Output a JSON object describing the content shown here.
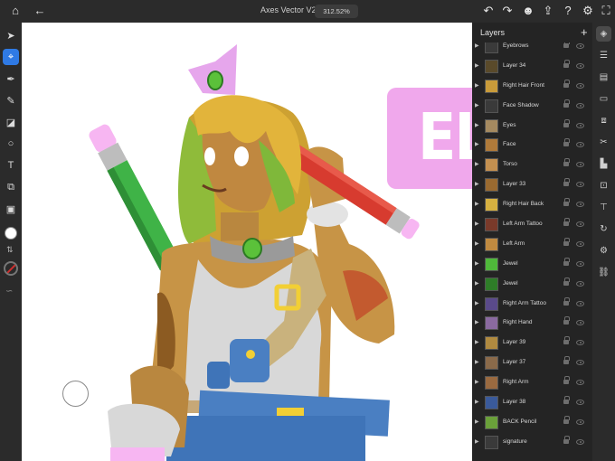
{
  "topbar": {
    "title": "Axes Vector V2*",
    "zoom": "312.52%"
  },
  "toolbar": {
    "tools": [
      {
        "name": "selection-tool",
        "icon": "arrow-cursor-icon",
        "glyph": "➤",
        "active": false
      },
      {
        "name": "direct-selection-tool",
        "icon": "node-select-icon",
        "glyph": "⌖",
        "active": true
      },
      {
        "name": "pen-tool",
        "icon": "pen-nib-icon",
        "glyph": "✒",
        "active": false
      },
      {
        "name": "brush-tool",
        "icon": "brush-icon",
        "glyph": "✎",
        "active": false
      },
      {
        "name": "eraser-tool",
        "icon": "eraser-icon",
        "glyph": "◪",
        "active": false
      },
      {
        "name": "shape-tool",
        "icon": "circle-shape-icon",
        "glyph": "○",
        "active": false
      },
      {
        "name": "type-tool",
        "icon": "text-t-icon",
        "glyph": "T",
        "active": false
      },
      {
        "name": "transform-tool",
        "icon": "crop-transform-icon",
        "glyph": "⧉",
        "active": false
      },
      {
        "name": "image-tool",
        "icon": "image-icon",
        "glyph": "▣",
        "active": false
      }
    ],
    "fill_color": "#ffffff",
    "stroke_color": "#d0302f"
  },
  "canvas": {
    "banner_text": "ELR",
    "banner_color": "#f0a8ec"
  },
  "layers": {
    "title": "Layers",
    "add_label": "+",
    "items": [
      {
        "label": "Eyebrows",
        "thumb": "#3a3a3a"
      },
      {
        "label": "Layer 34",
        "thumb": "#5a4a2a"
      },
      {
        "label": "Right Hair Front",
        "thumb": "#c99b3a"
      },
      {
        "label": "Face Shadow",
        "thumb": "#3a3a3a"
      },
      {
        "label": "Eyes",
        "thumb": "#a58a60"
      },
      {
        "label": "Face",
        "thumb": "#b07a3a"
      },
      {
        "label": "Torso",
        "thumb": "#c49050"
      },
      {
        "label": "Layer 33",
        "thumb": "#9a6a30"
      },
      {
        "label": "Right Hair Back",
        "thumb": "#d6b040"
      },
      {
        "label": "Left Arm Tattoo",
        "thumb": "#7a3a2a"
      },
      {
        "label": "Left Arm",
        "thumb": "#c08a40"
      },
      {
        "label": "Jewel",
        "thumb": "#4fb83a"
      },
      {
        "label": "Jewel",
        "thumb": "#2e7d28"
      },
      {
        "label": "Right Arm Tattoo",
        "thumb": "#5a4a8a"
      },
      {
        "label": "Right Hand",
        "thumb": "#8a6aa0"
      },
      {
        "label": "Layer 39",
        "thumb": "#b08a40"
      },
      {
        "label": "Layer 37",
        "thumb": "#8a6a4a"
      },
      {
        "label": "Right Arm",
        "thumb": "#9a6a40"
      },
      {
        "label": "Layer 38",
        "thumb": "#3a5a9a"
      },
      {
        "label": "BACK Pencil",
        "thumb": "#6aa03a"
      },
      {
        "label": "signature",
        "thumb": "#3a3a3a"
      }
    ]
  },
  "right_strip": {
    "tools": [
      {
        "name": "layers-panel-button",
        "icon": "layers-stack-icon",
        "glyph": "◈",
        "active": true
      },
      {
        "name": "properties-button",
        "icon": "sliders-icon",
        "glyph": "☰",
        "active": false
      },
      {
        "name": "libraries-button",
        "icon": "library-icon",
        "glyph": "▤",
        "active": false
      },
      {
        "name": "comments-button",
        "icon": "comment-bubble-icon",
        "glyph": "▭",
        "active": false
      },
      {
        "name": "combine-button",
        "icon": "combine-shapes-icon",
        "glyph": "⧈",
        "active": false
      },
      {
        "name": "cut-button",
        "icon": "scissors-icon",
        "glyph": "✂",
        "active": false
      },
      {
        "name": "align-button",
        "icon": "align-icon",
        "glyph": "▙",
        "active": false
      },
      {
        "name": "arrange-button",
        "icon": "arrange-icon",
        "glyph": "⊡",
        "active": false
      },
      {
        "name": "transform-button",
        "icon": "transform-icon",
        "glyph": "⊤",
        "active": false
      },
      {
        "name": "rotate-button",
        "icon": "rotate-icon",
        "glyph": "↻",
        "active": false
      },
      {
        "name": "settings-button",
        "icon": "gear-icon",
        "glyph": "⚙",
        "active": false
      },
      {
        "name": "link-button",
        "icon": "link-icon",
        "glyph": "⛓",
        "active": false
      }
    ]
  }
}
